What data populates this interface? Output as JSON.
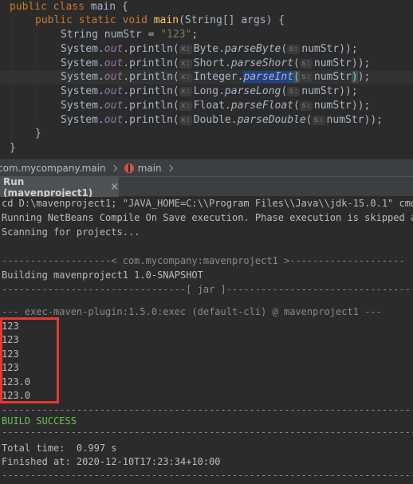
{
  "editor": {
    "lines": {
      "l0": {
        "kw1": "public",
        "kw2": "class",
        "name": "main {"
      },
      "l1": {
        "kw1": "public",
        "kw2": "static",
        "kw3": "void",
        "method": "main",
        "rest": "(String[] args) {"
      },
      "l2": {
        "a": "String numStr = ",
        "str": "\"123\"",
        "b": ";"
      },
      "l3": {
        "a": "System.",
        "out": "out",
        "b": ".println(",
        "hint": "x:",
        "c": "Byte.",
        "m": "parseByte",
        "d": "(",
        "hint2": "s:",
        "e": "numStr));"
      },
      "l4": {
        "a": "System.",
        "out": "out",
        "b": ".println(",
        "hint": "x:",
        "c": "Short.",
        "m": "parseShort",
        "d": "(",
        "hint2": "s:",
        "e": "numStr));"
      },
      "l5": {
        "a": "System.",
        "out": "out",
        "b": ".println(",
        "hint": "x:",
        "c": "Integer.",
        "m": "parseInt",
        "d": "(",
        "hint2": "s:",
        "e": "numStr",
        "f": ")",
        "g": ");"
      },
      "l6": {
        "a": "System.",
        "out": "out",
        "b": ".println(",
        "hint": "x:",
        "c": "Long.",
        "m": "parseLong",
        "d": "(",
        "hint2": "s:",
        "e": "numStr));"
      },
      "l7": {
        "a": "System.",
        "out": "out",
        "b": ".println(",
        "hint": "x:",
        "c": "Float.",
        "m": "parseFloat",
        "d": "(",
        "hint2": "s:",
        "e": "numStr));"
      },
      "l8": {
        "a": "System.",
        "out": "out",
        "b": ".println(",
        "hint": "x:",
        "c": "Double.",
        "m": "parseDouble",
        "d": "(",
        "hint2": "s:",
        "e": "numStr));"
      },
      "l9": {
        "a": "}"
      },
      "l10": {
        "a": "}"
      }
    }
  },
  "breadcrumb": {
    "package": "com.mycompany.main",
    "method": "main"
  },
  "run_panel": {
    "tab_label": "Run (mavenproject1)",
    "close_glyph": "×"
  },
  "output": {
    "lines": [
      "cd D:\\mavenproject1; \"JAVA_HOME=C:\\\\Program Files\\\\Java\\\\jdk-15.0.1\" cmd /",
      "Running NetBeans Compile On Save execution. Phase execution is skipped and",
      "Scanning for projects...",
      "",
      "-------------------< com.mycompany:mavenproject1 >--------------------",
      "Building mavenproject1 1.0-SNAPSHOT",
      "--------------------------------[ jar ]---------------------------------",
      "",
      "--- exec-maven-plugin:1.5.0:exec (default-cli) @ mavenproject1 ---",
      "123",
      "123",
      "123",
      "123",
      "123.0",
      "123.0",
      "------------------------------------------------------------------------",
      "BUILD SUCCESS",
      "------------------------------------------------------------------------",
      "Total time:  0.997 s",
      "Finished at: 2020-12-10T17:23:34+10:00",
      "------------------------------------------------------------------------"
    ]
  },
  "colors": {
    "keyword": "#cc7832",
    "method": "#ffc66d",
    "string": "#6a8759",
    "field": "#9876aa",
    "success": "#65c455",
    "highlight_box": "#e53935"
  }
}
